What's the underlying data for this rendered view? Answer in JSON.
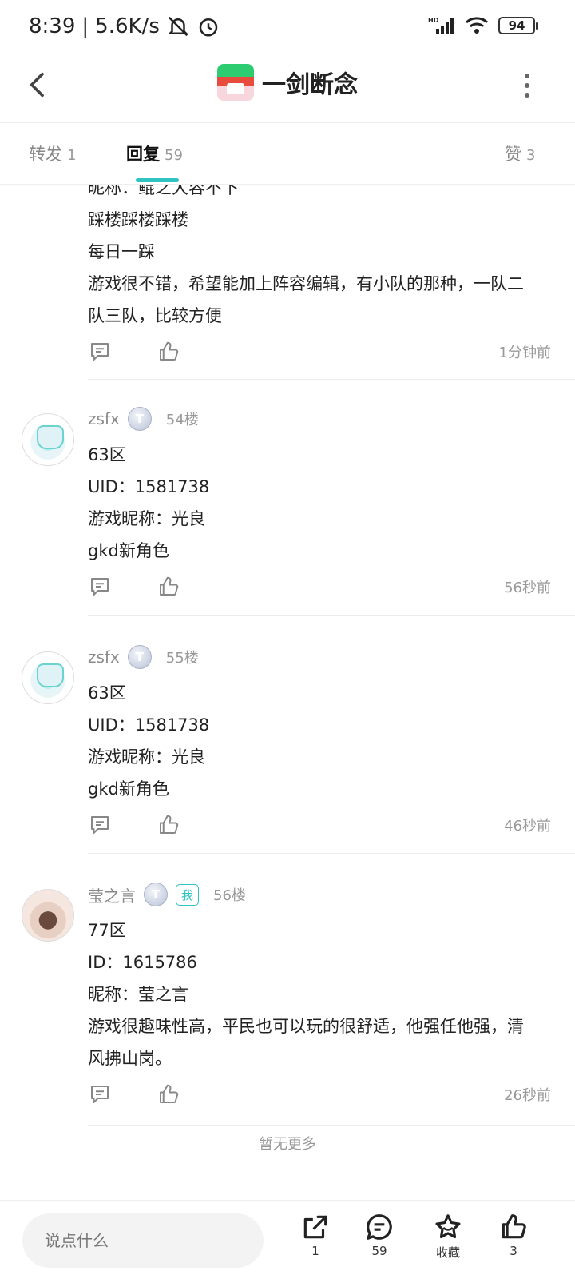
{
  "status_bar": {
    "time": "8:39",
    "speed": "5.6K/s",
    "battery": "94",
    "network": "HD"
  },
  "header": {
    "title": "一剑断念"
  },
  "tabs": [
    {
      "label": "转发",
      "count": "1"
    },
    {
      "label": "回复",
      "count": "59"
    },
    {
      "label": "赞",
      "count": "3"
    }
  ],
  "posts": [
    {
      "lines": [
        "昵称：鲲之大容不下",
        "踩楼踩楼踩楼",
        "每日一踩",
        "游戏很不错，希望能加上阵容编辑，有小队的那种，一队二",
        "队三队，比较方便"
      ],
      "time": "1分钟前"
    },
    {
      "username": "zsfx",
      "level": "T",
      "floor": "54楼",
      "lines": [
        "63区",
        "UID：1581738",
        "游戏昵称：光良",
        "gkd新角色"
      ],
      "time": "56秒前"
    },
    {
      "username": "zsfx",
      "level": "T",
      "floor": "55楼",
      "lines": [
        "63区",
        "UID：1581738",
        "游戏昵称：光良",
        "gkd新角色"
      ],
      "time": "46秒前"
    },
    {
      "username": "莹之言",
      "level": "T",
      "me_badge": "我",
      "floor": "56楼",
      "lines": [
        "77区",
        "ID：1615786",
        "昵称：莹之言",
        "游戏很趣味性高，平民也可以玩的很舒适，他强任他强，清",
        "风拂山岗。"
      ],
      "time": "26秒前"
    }
  ],
  "no_more": "暂无更多",
  "bottom_bar": {
    "input_placeholder": "说点什么",
    "share_count": "1",
    "comment_count": "59",
    "collect_label": "收藏",
    "like_count": "3"
  },
  "colors": {
    "accent": "#2fc3c1",
    "muted": "#999999"
  }
}
